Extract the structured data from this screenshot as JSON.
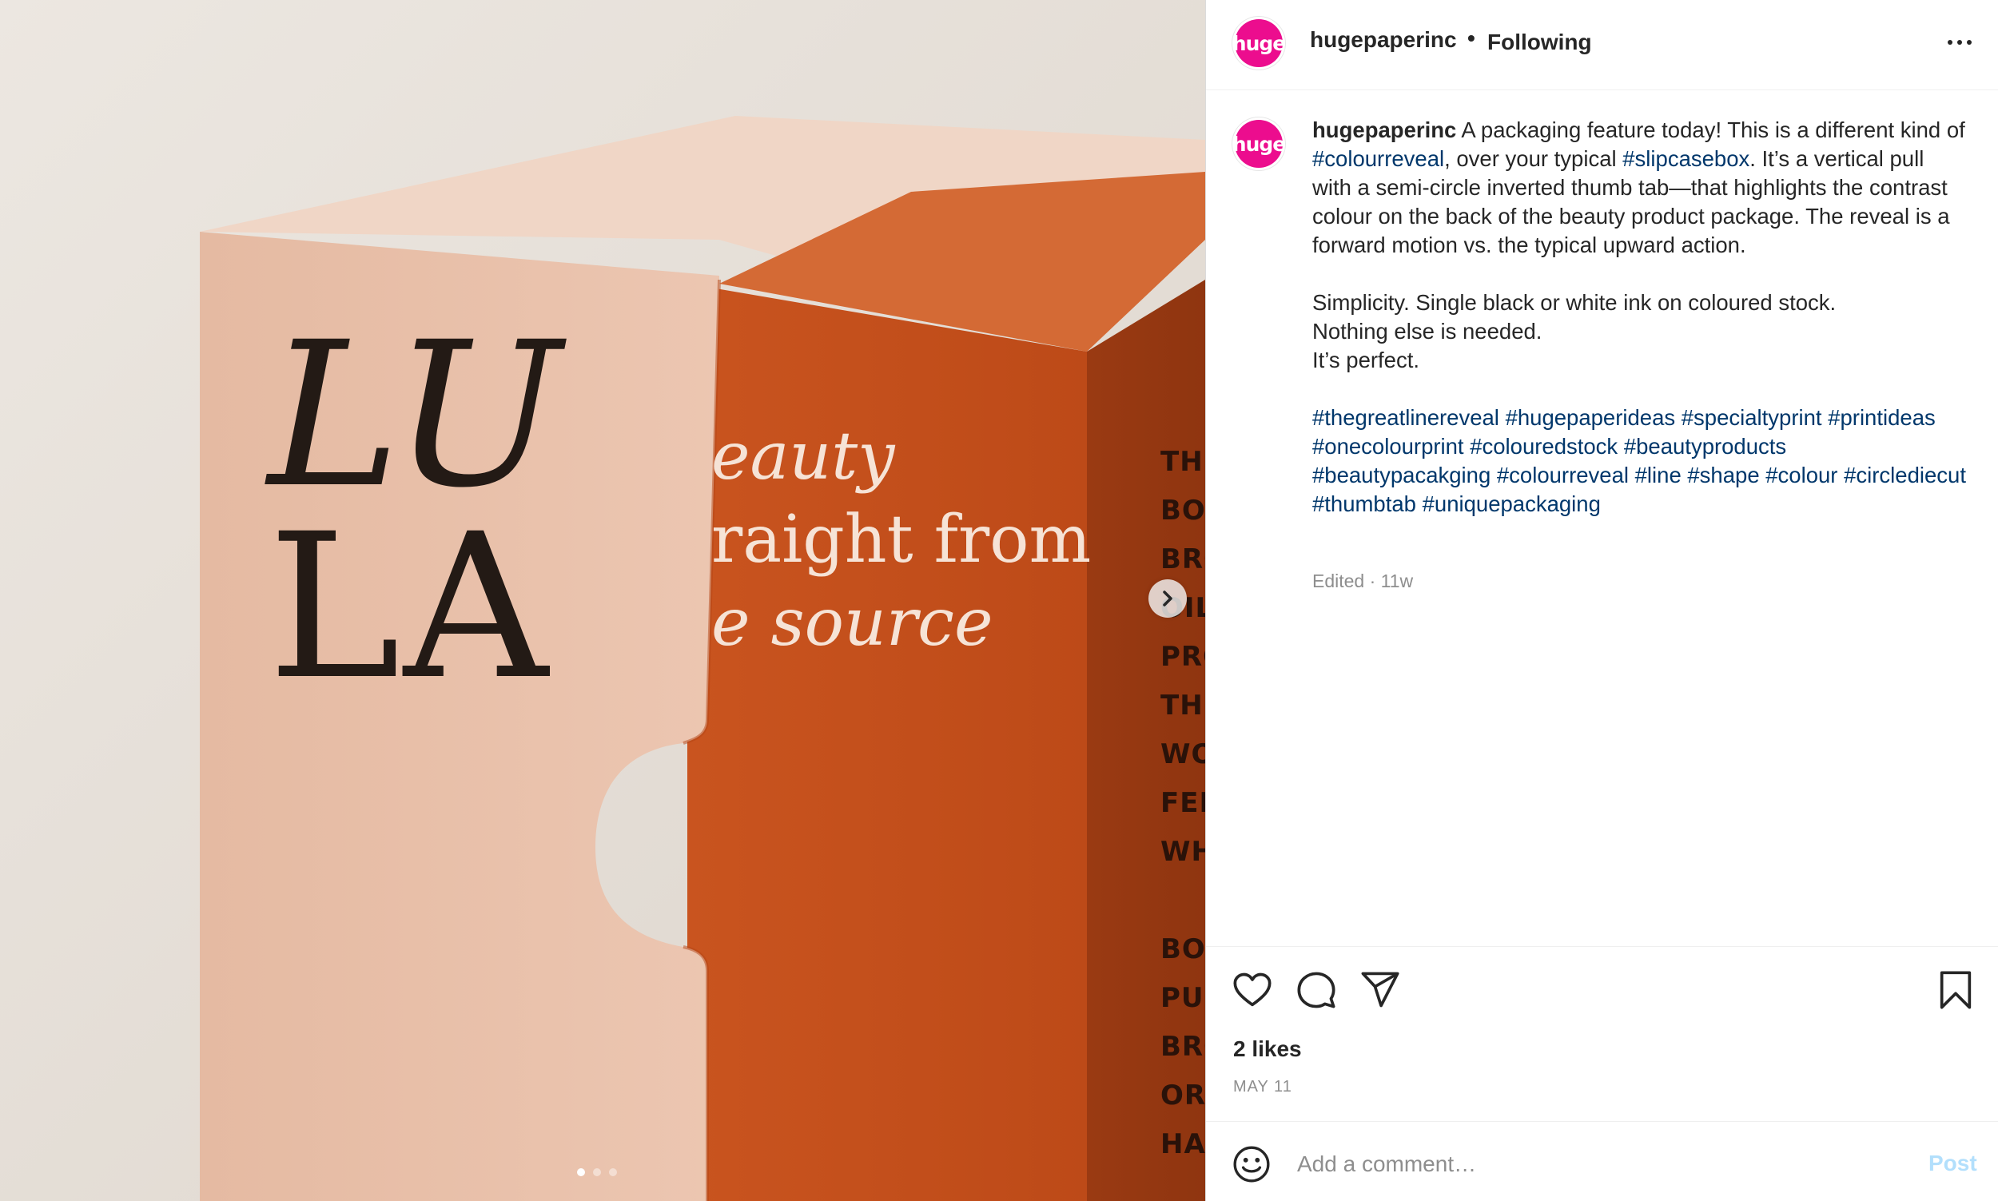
{
  "post": {
    "username": "hugepaperinc",
    "avatar_text": "huge",
    "follow_separator": "•",
    "follow_status": "Following",
    "more_icon": "more-horizontal-icon",
    "brand_color": "#ec0d8e",
    "hashtag_color": "#00376b"
  },
  "media": {
    "box_logo_line1": "LU",
    "box_logo_line2": "LA",
    "box_tagline": [
      "eauty",
      "raight from",
      "e source"
    ],
    "side_text": [
      "THIS",
      "BOT",
      "BRO",
      "",
      "OIL",
      "PRO",
      "THIS",
      "WOR",
      "FEEL",
      "WHI",
      "",
      "BOT",
      "PUR",
      "BRO",
      "ORA",
      "HAZ"
    ],
    "next_icon": "chevron-right-icon",
    "slide_count": 3,
    "active_slide": 1
  },
  "caption": {
    "username": "hugepaperinc",
    "t1": " A packaging feature today! This is a different kind of ",
    "tag1": "#colourreveal",
    "t2": ", over your typical ",
    "tag2": "#slipcasebox",
    "t3": ". It’s a vertical pull with a semi-circle inverted thumb tab—that highlights the contrast colour on the back of the beauty product package. The reveal is a forward motion vs. the typical upward action.",
    "p2_line1": "Simplicity. Single black or white ink on coloured stock.",
    "p2_line2": "Nothing else is needed.",
    "p2_line3": "It’s perfect.",
    "hashtags": [
      "#thegreatlinereveal",
      "#hugepaperideas",
      "#specialtyprint",
      "#printideas",
      "#onecolourprint",
      "#colouredstock",
      "#beautyproducts",
      "#beautypacakging",
      "#colourreveal",
      "#line",
      "#shape",
      "#colour",
      "#circlediecut",
      "#thumbtab",
      "#uniquepackaging"
    ],
    "edited": "Edited · 11w"
  },
  "actions": {
    "like_icon": "heart-icon",
    "comment_icon": "comment-bubble-icon",
    "share_icon": "paper-plane-icon",
    "save_icon": "bookmark-icon",
    "likes": "2 likes",
    "date": "MAY 11"
  },
  "comment_box": {
    "emoji_icon": "smiley-face-icon",
    "placeholder": "Add a comment…",
    "post_label": "Post"
  }
}
